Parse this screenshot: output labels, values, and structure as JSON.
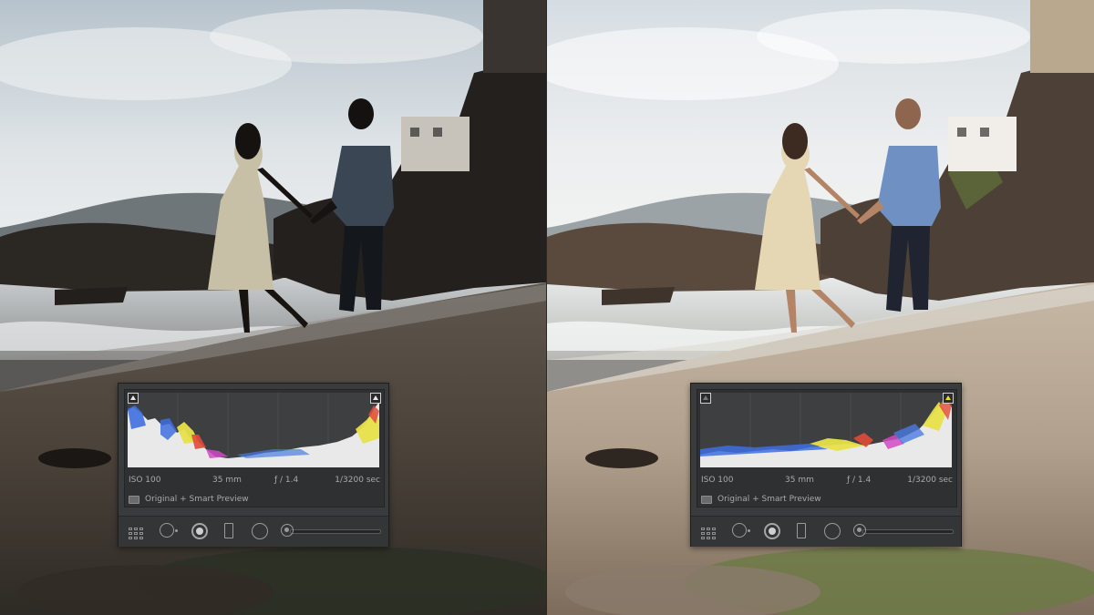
{
  "panels": [
    {
      "iso": "ISO 100",
      "focal_length": "35 mm",
      "aperture": "ƒ / 1.4",
      "shutter": "1/3200 sec",
      "preview_label": "Original + Smart Preview",
      "colors": {
        "sky": "#d9dfe3",
        "sand": "#6e6154",
        "rock": "#2a2521",
        "skin": "#1c1714",
        "dress": "#bcb49b",
        "shirt": "#3a4654"
      }
    },
    {
      "iso": "ISO 100",
      "focal_length": "35 mm",
      "aperture": "ƒ / 1.4",
      "shutter": "1/3200 sec",
      "preview_label": "Original + Smart Preview",
      "colors": {
        "sky": "#eef0f1",
        "sand": "#b3a391",
        "rock": "#5a4a3d",
        "skin": "#a77d63",
        "dress": "#e4d6b6",
        "shirt": "#6f90c2"
      }
    }
  ]
}
